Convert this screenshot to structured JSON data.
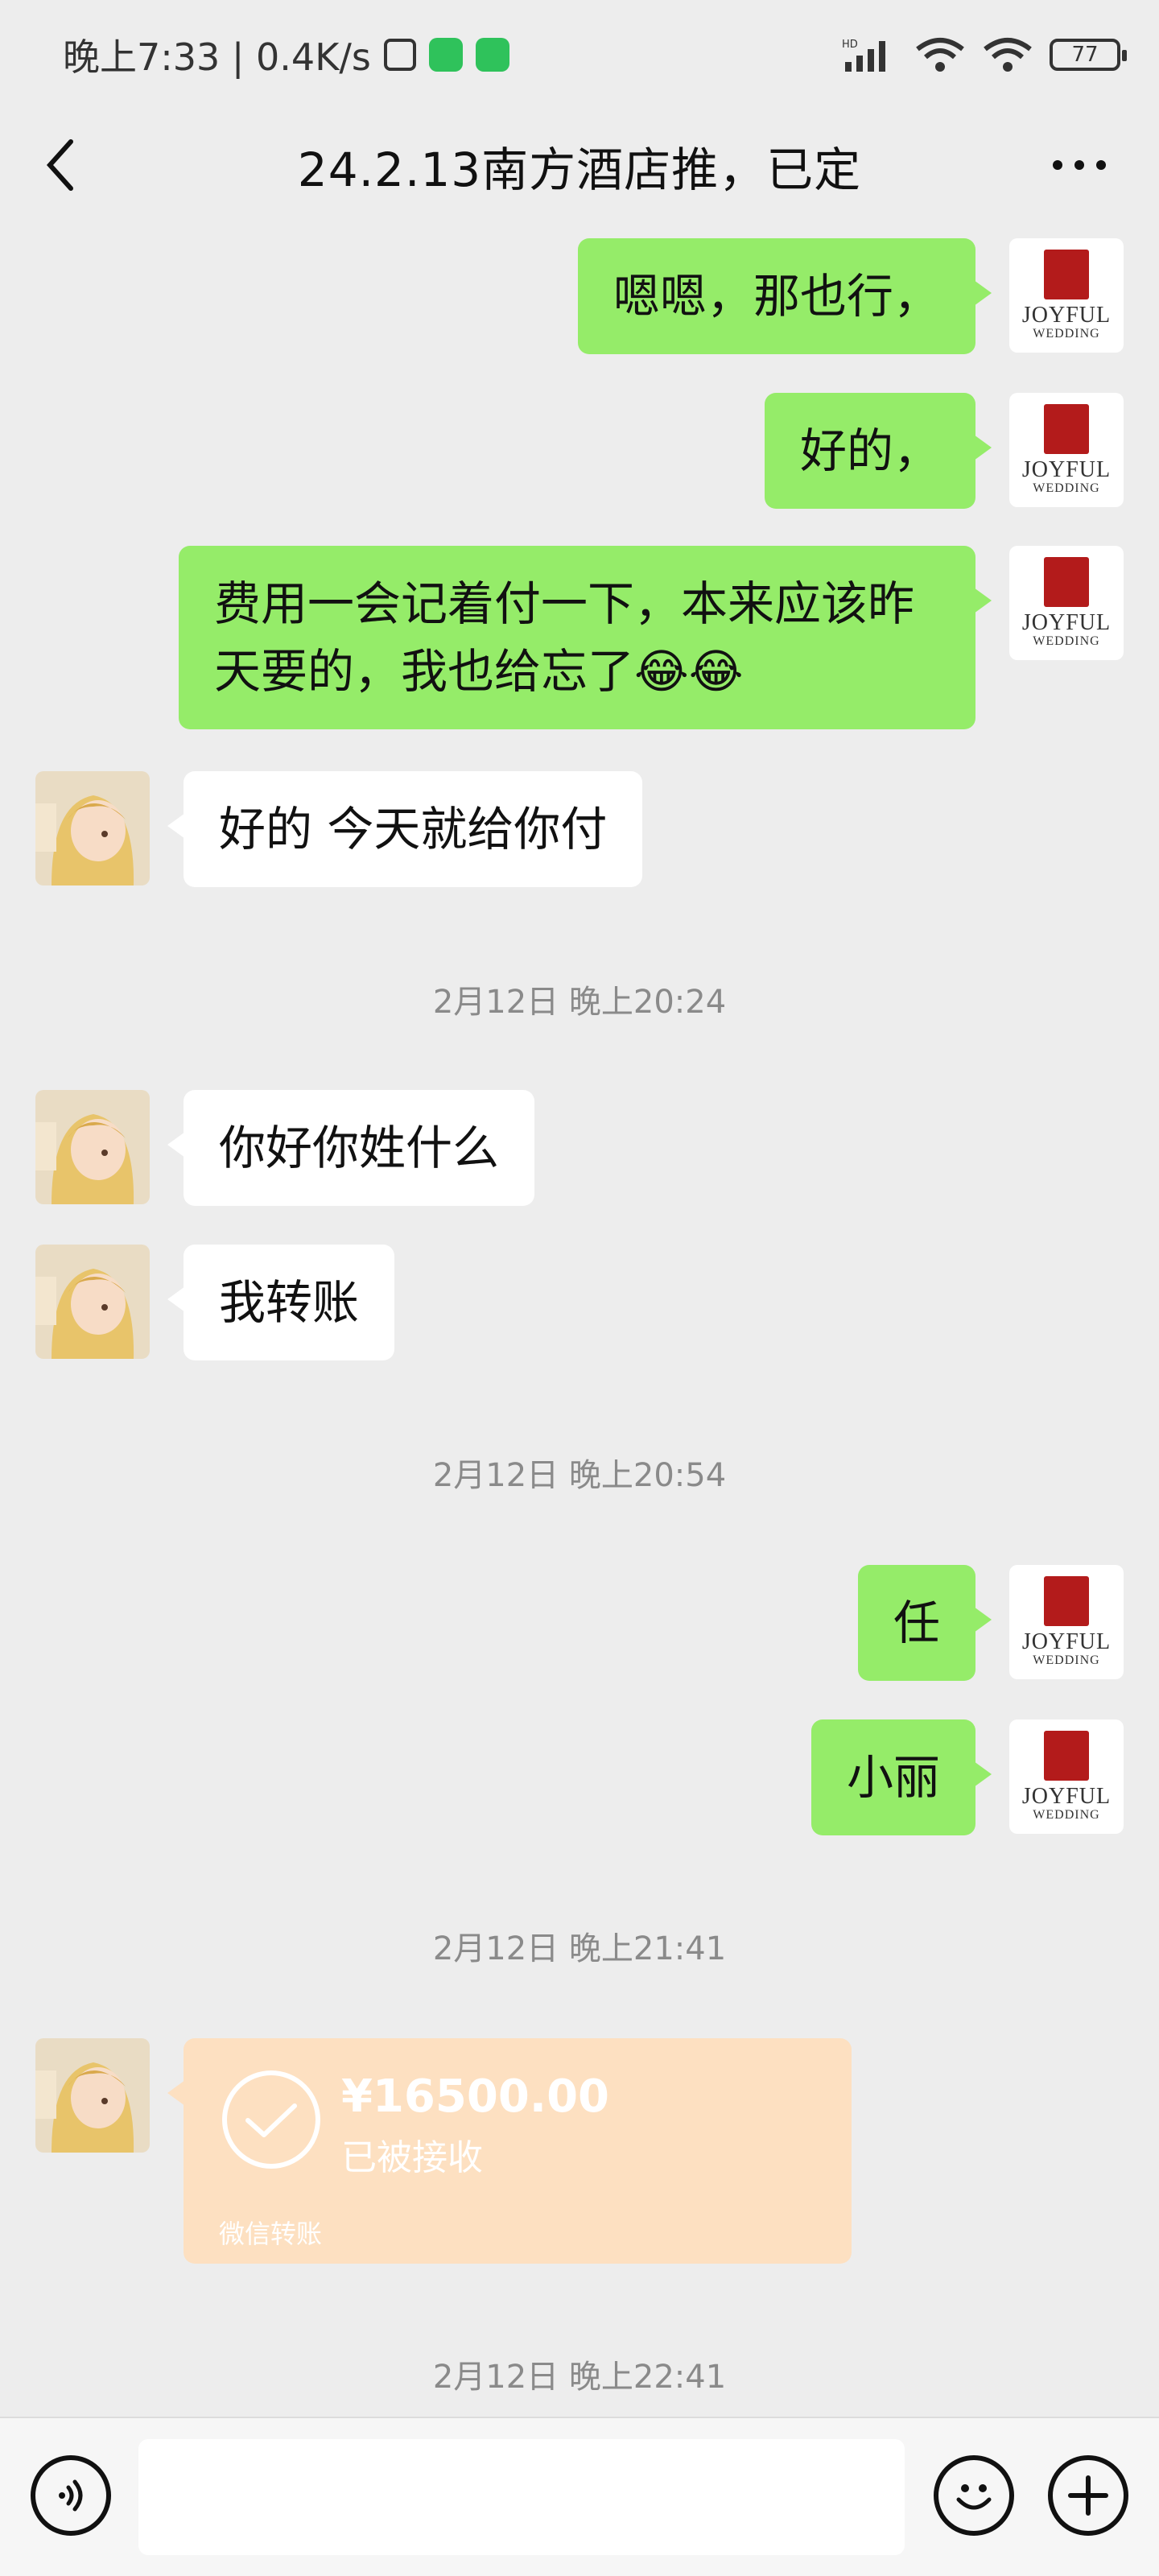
{
  "status_bar": {
    "time_and_speed": "晚上7:33 | 0.4K/s",
    "battery": "77"
  },
  "header": {
    "title": "24.2.13南方酒店推，已定"
  },
  "avatar_me": {
    "brand": "JOYFUL",
    "brand_sub": "WEDDING"
  },
  "messages": [
    {
      "side": "me",
      "text": "嗯嗯，那也行，"
    },
    {
      "side": "me",
      "text": "好的，"
    },
    {
      "side": "me",
      "text_line1": "费用一会记着付一下，本来应该昨",
      "text_line2": "天要的，我也给忘了",
      "emoji": "😂😂"
    },
    {
      "side": "other",
      "text": "好的 今天就给你付"
    },
    {
      "side": "other",
      "text": "你好你姓什么"
    },
    {
      "side": "other",
      "text": "我转账"
    },
    {
      "side": "me",
      "text": "任"
    },
    {
      "side": "me",
      "text": "小丽"
    }
  ],
  "timestamps": [
    "2月12日 晚上20:24",
    "2月12日 晚上20:54",
    "2月12日 晚上21:41",
    "2月12日 晚上22:41"
  ],
  "transfer": {
    "amount": "¥16500.00",
    "status": "已被接收",
    "label": "微信转账"
  },
  "input_bar": {
    "placeholder": ""
  },
  "colors": {
    "background": "#ededed",
    "my_bubble": "#95ec69",
    "other_bubble": "#ffffff",
    "transfer_card": "#fde0c1",
    "timestamp_text": "#8a8a8a"
  }
}
